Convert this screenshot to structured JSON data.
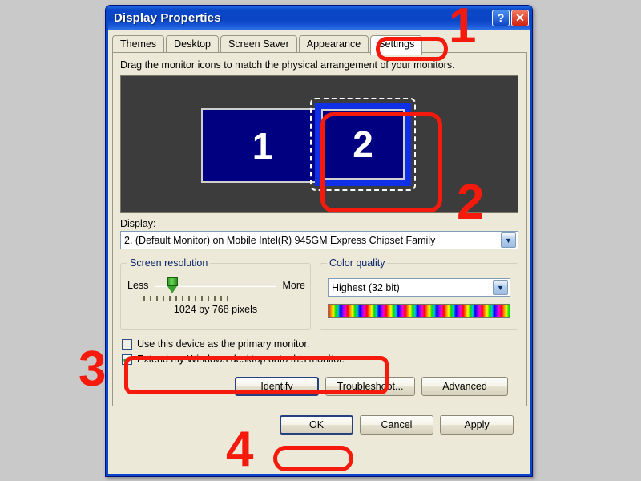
{
  "window": {
    "title": "Display Properties",
    "help_button": "?",
    "close_button": "✕"
  },
  "tabs": [
    {
      "label": "Themes",
      "active": false
    },
    {
      "label": "Desktop",
      "active": false
    },
    {
      "label": "Screen Saver",
      "active": false
    },
    {
      "label": "Appearance",
      "active": false
    },
    {
      "label": "Settings",
      "active": true
    }
  ],
  "settings_page": {
    "hint": "Drag the monitor icons to match the physical arrangement of your monitors.",
    "monitors": [
      {
        "number": "1",
        "selected": false
      },
      {
        "number": "2",
        "selected": true
      }
    ],
    "display": {
      "label": "Display:",
      "value": "2. (Default Monitor) on Mobile Intel(R) 945GM Express Chipset Family",
      "arrow": "▼"
    },
    "screen_resolution": {
      "group_label": "Screen resolution",
      "less_label": "Less",
      "more_label": "More",
      "value_text": "1024 by 768 pixels"
    },
    "color_quality": {
      "group_label": "Color quality",
      "value": "Highest (32 bit)",
      "arrow": "▼"
    },
    "checkboxes": [
      {
        "label": "Use this device as the primary monitor.",
        "checked": false,
        "mark": ""
      },
      {
        "label": "Extend my Windows desktop onto this monitor.",
        "checked": true,
        "mark": "✔"
      }
    ],
    "action_buttons": [
      {
        "label": "Identify",
        "default": true
      },
      {
        "label": "Troubleshoot...",
        "default": false
      },
      {
        "label": "Advanced",
        "default": false
      }
    ]
  },
  "dialog_buttons": [
    {
      "label": "OK"
    },
    {
      "label": "Cancel"
    },
    {
      "label": "Apply"
    }
  ],
  "annotations": {
    "step_1": "1",
    "step_2": "2",
    "step_3": "3",
    "step_4": "4",
    "color": "#f61a0d"
  }
}
